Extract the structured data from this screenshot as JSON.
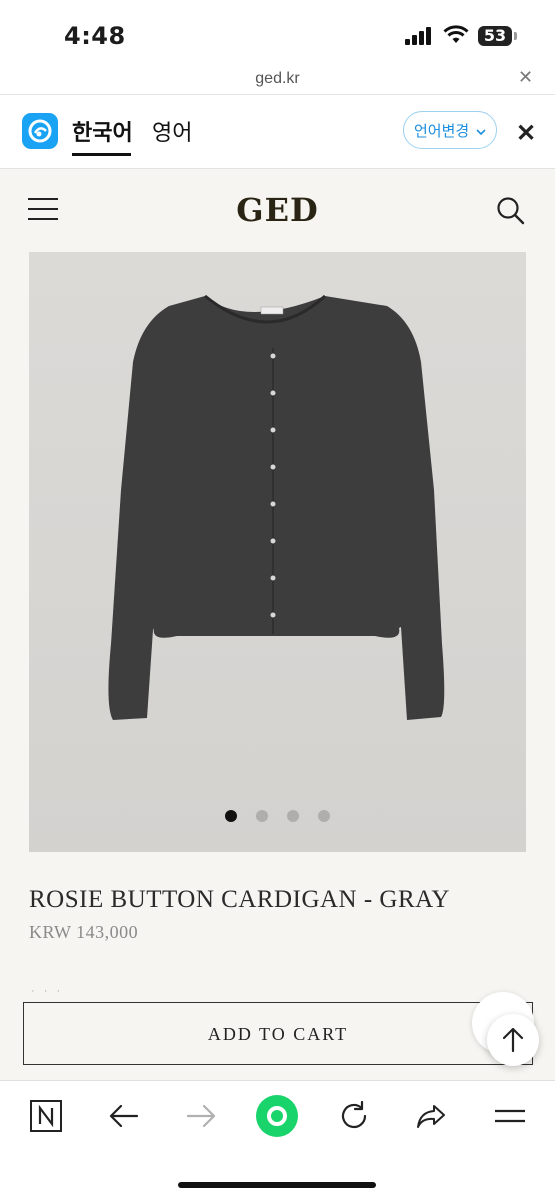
{
  "status": {
    "time": "4:48",
    "battery": "53"
  },
  "browser": {
    "url": "ged.kr"
  },
  "translate": {
    "lang_active": "한국어",
    "lang_other": "영어",
    "change_label": "언어변경"
  },
  "header": {
    "brand": "GED"
  },
  "gallery": {
    "slide_count": 4,
    "active_index": 0
  },
  "product": {
    "title": "ROSIE BUTTON CARDIGAN - GRAY",
    "price": "KRW 143,000"
  },
  "actions": {
    "add_to_cart": "ADD TO CART"
  },
  "icons": {
    "menu": "hamburger-icon",
    "search": "search-icon",
    "close": "close-icon",
    "back": "arrow-left-icon",
    "forward": "arrow-right-icon",
    "reload": "reload-icon",
    "share": "share-icon",
    "up": "arrow-up-icon"
  },
  "colors": {
    "accent": "#1aa3f5",
    "green_button": "#19d36b",
    "brand": "#2a2414"
  }
}
